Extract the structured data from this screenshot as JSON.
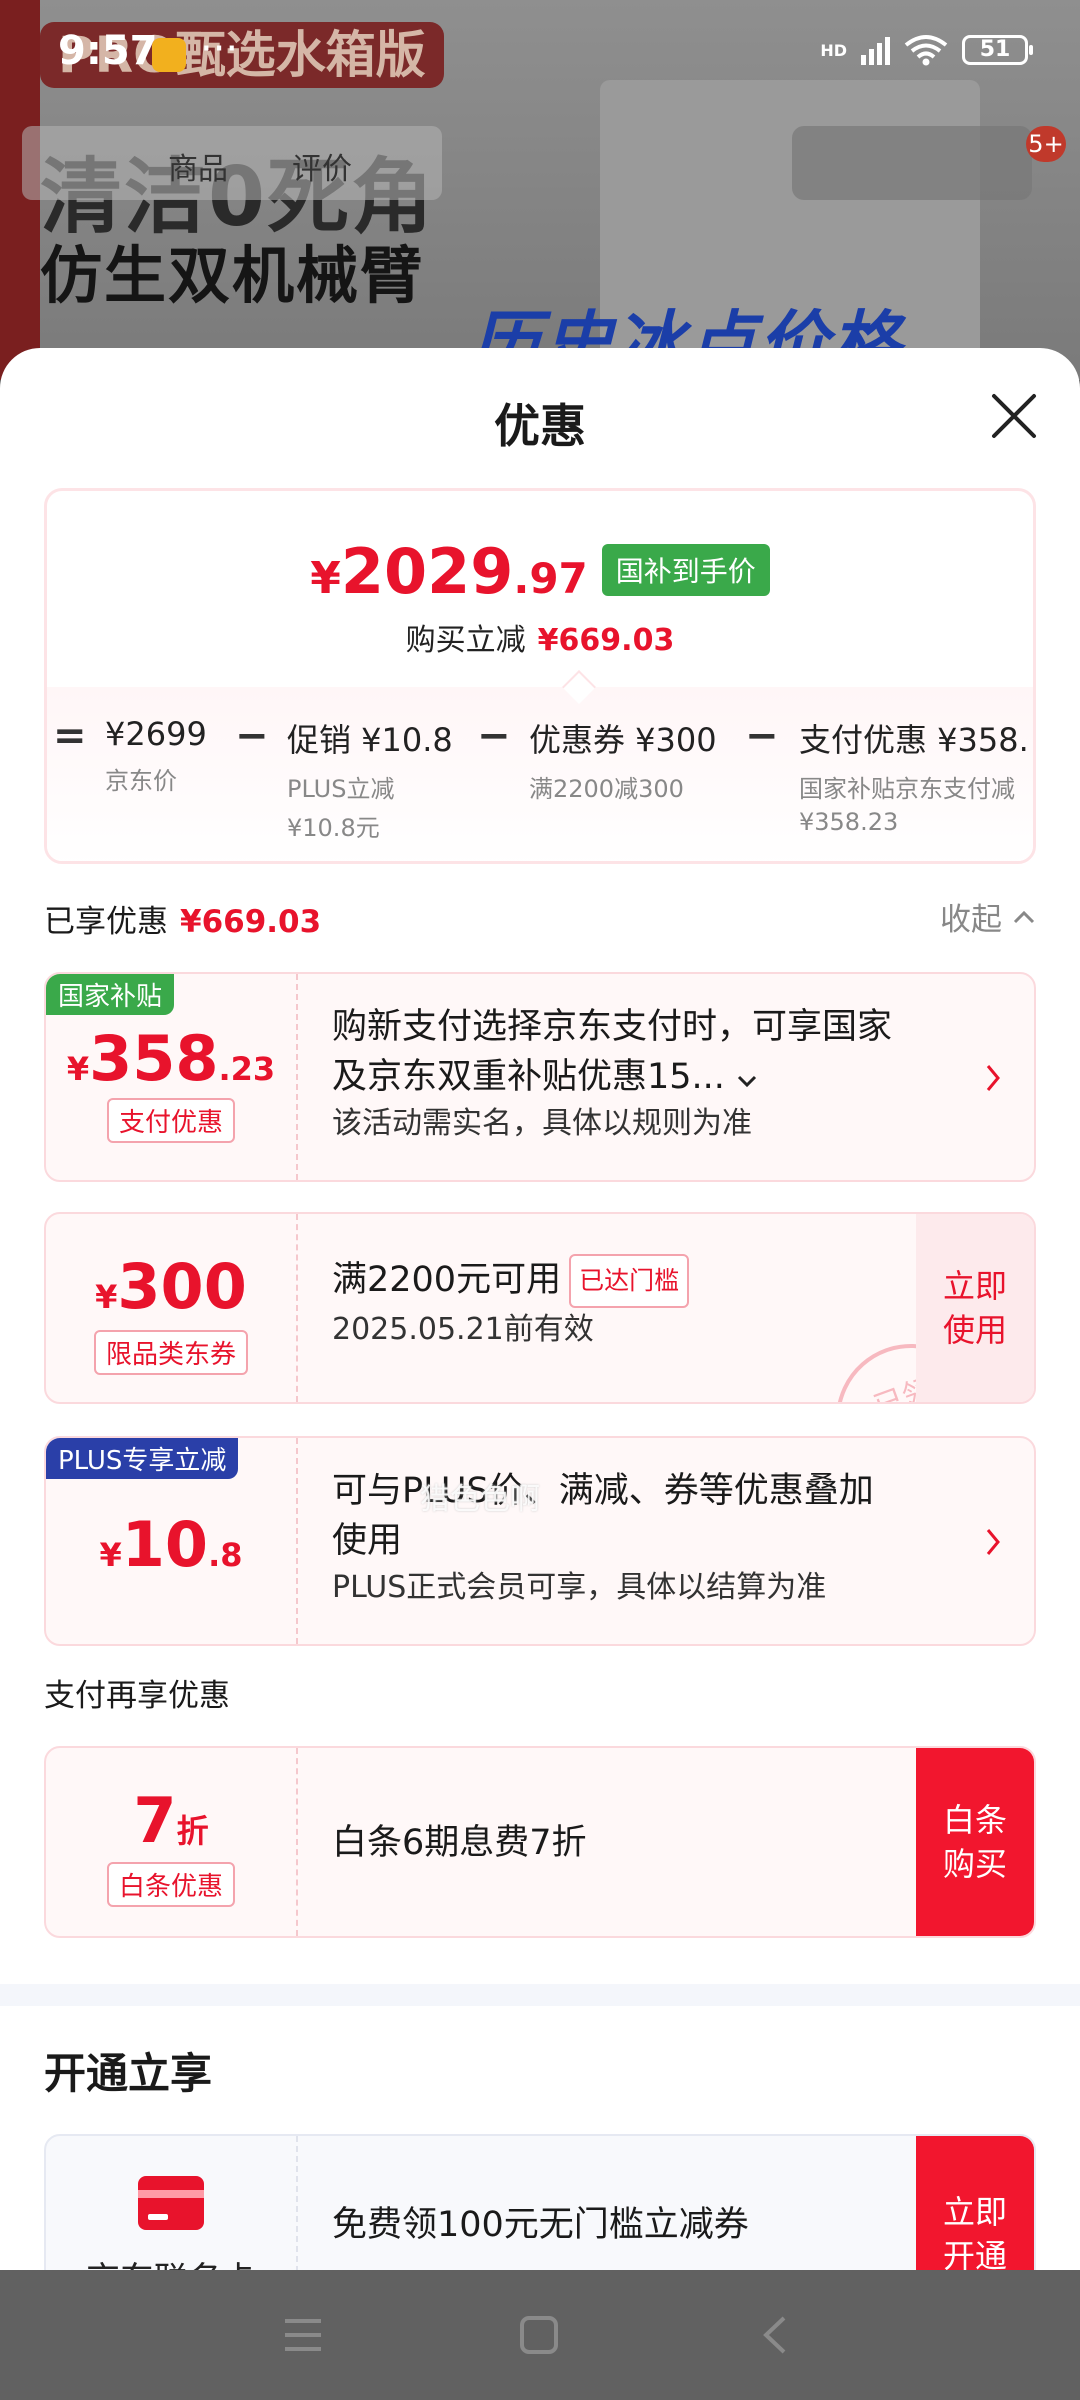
{
  "status_bar": {
    "time": "9:57",
    "more": "···",
    "network": "HD",
    "battery": "51"
  },
  "background_page": {
    "tagline": "PRO甄选水箱版",
    "headline1": "清洁0死角",
    "headline2": "仿生双机械臂",
    "promo": "历史冰点价格",
    "tab_goods": "商品",
    "tab_review": "评价",
    "cart_badge": "5+"
  },
  "sheet": {
    "title": "优惠"
  },
  "price_summary": {
    "yen": "¥",
    "final_int": "2029",
    "final_dec": ".97",
    "tag": "国补到手价",
    "saving_label": "购买立减",
    "saving_value": "¥669.03",
    "breakdown": {
      "equals": "=",
      "jd_price": "¥2699",
      "jd_price_label": "京东价",
      "minus1": "−",
      "promo": "促销 ¥10.8",
      "promo_sub1": "PLUS立减",
      "promo_sub2": "¥10.8元",
      "minus2": "−",
      "coupon": "优惠券 ¥300",
      "coupon_sub": "满2200减300",
      "minus3": "−",
      "pay": "支付优惠 ¥358.",
      "pay_sub1": "国家补贴京东支付减",
      "pay_sub2": "¥358.23"
    }
  },
  "enjoyed": {
    "label": "已享优惠",
    "value": "¥669.03",
    "collapse": "收起"
  },
  "offers": [
    {
      "corner": "国家补贴",
      "yen": "¥",
      "amount": "358",
      "amount_small": ".23",
      "tag": "支付优惠",
      "title_line1": "购新支付选择京东支付时，可享国家",
      "title_line2": "及京东双重补贴优惠15...",
      "sub": "该活动需实名，具体以规则为准"
    },
    {
      "yen": "¥",
      "amount": "300",
      "tag": "限品类东券",
      "title": "满2200元可用",
      "threshold": "已达门槛",
      "sub": "2025.05.21前有效",
      "button_line1": "立即",
      "button_line2": "使用",
      "stamp": "已领"
    },
    {
      "corner": "PLUS专享立减",
      "yen": "¥",
      "amount": "10",
      "amount_small": ".8",
      "title_line1": "可与PLUS价、满减、券等优惠叠加",
      "title_line2": "使用",
      "sub": "PLUS正式会员可享，具体以结算为准"
    }
  ],
  "watermark": "猎色色啊",
  "pay_section": {
    "title": "支付再享优惠",
    "discount": "7",
    "discount_unit": "折",
    "tag": "白条优惠",
    "desc": "白条6期息费7折",
    "button_line1": "白条",
    "button_line2": "购买"
  },
  "open_section": {
    "title": "开通立享",
    "card_name": "京东联名卡",
    "desc": "免费领100元无门槛立减券",
    "button_line1": "立即",
    "button_line2": "开通"
  },
  "colors": {
    "accent_red": "#e8132c",
    "guobu_green": "#3aa94a",
    "plus_blue": "#2a3fa8"
  }
}
